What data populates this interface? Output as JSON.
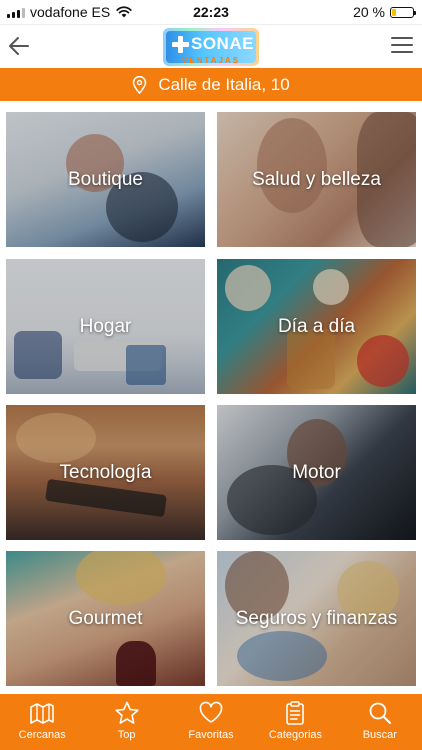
{
  "status_bar": {
    "carrier": "vodafone ES",
    "time": "22:23",
    "battery_percent": "20 %",
    "battery_level": 0.2
  },
  "header": {
    "logo_text": "SONAE",
    "logo_sub": "VENTAJAS",
    "back_icon": "arrow-left-icon",
    "menu_icon": "hamburger-menu-icon"
  },
  "location": {
    "address": "Calle de Italia, 10",
    "icon": "map-pin-icon"
  },
  "categories": [
    {
      "label": "Boutique"
    },
    {
      "label": "Salud y belleza"
    },
    {
      "label": "Hogar"
    },
    {
      "label": "Día a día"
    },
    {
      "label": "Tecnología"
    },
    {
      "label": "Motor"
    },
    {
      "label": "Gourmet"
    },
    {
      "label": "Seguros y finanzas"
    }
  ],
  "tabs": [
    {
      "label": "Cercanas",
      "icon": "map-icon"
    },
    {
      "label": "Top",
      "icon": "star-icon"
    },
    {
      "label": "Favoritas",
      "icon": "heart-icon"
    },
    {
      "label": "Categorias",
      "icon": "clipboard-list-icon"
    },
    {
      "label": "Buscar",
      "icon": "search-icon"
    }
  ],
  "colors": {
    "accent": "#f47d0f",
    "battery": "#f2c200"
  }
}
